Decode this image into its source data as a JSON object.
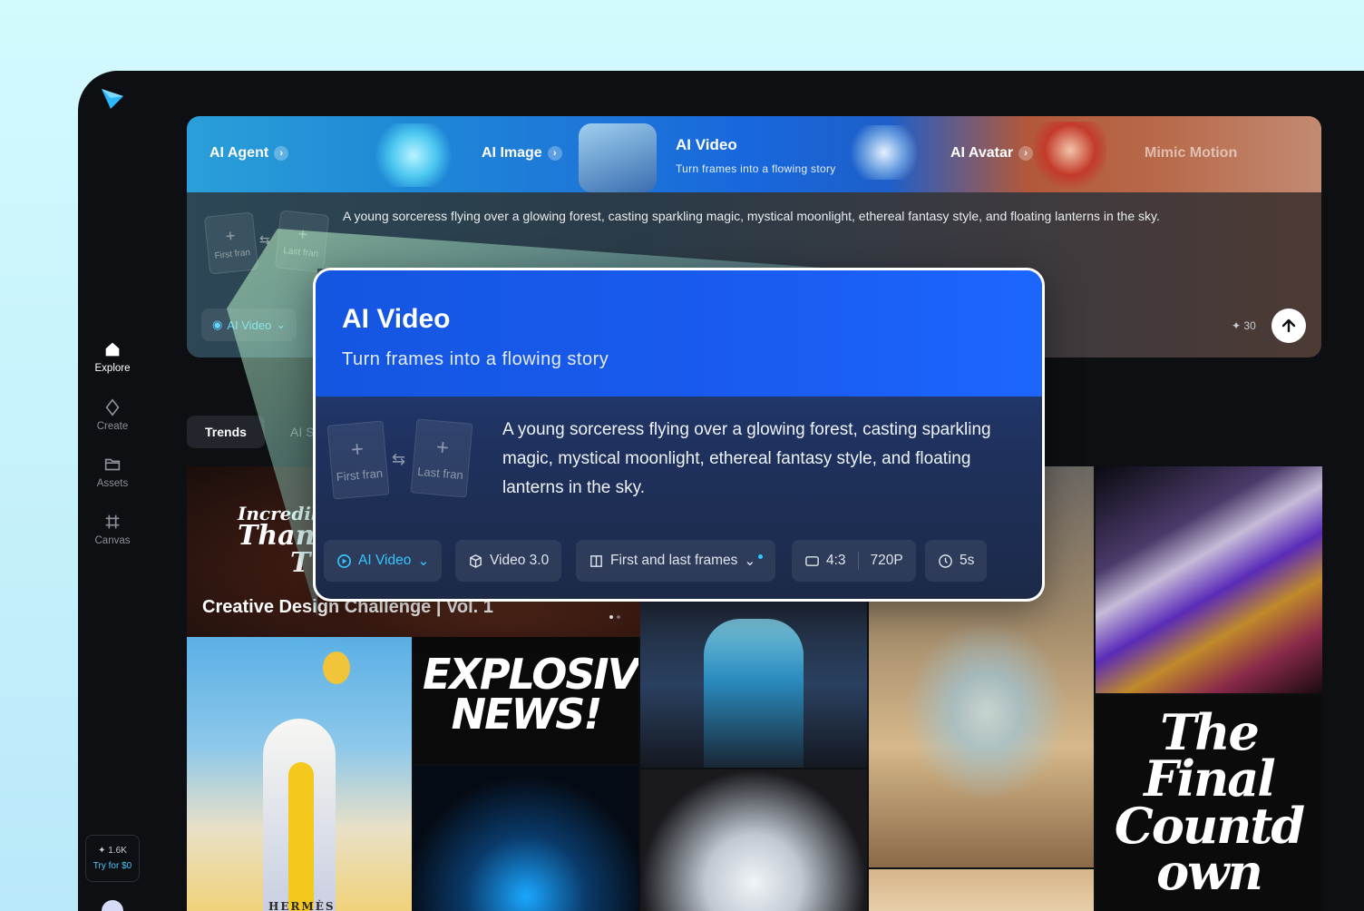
{
  "sidebar": {
    "nav": [
      {
        "label": "Explore",
        "icon": "home-icon",
        "active": true
      },
      {
        "label": "Create",
        "icon": "sparkle-icon",
        "active": false
      },
      {
        "label": "Assets",
        "icon": "folder-icon",
        "active": false
      },
      {
        "label": "Canvas",
        "icon": "canvas-icon",
        "active": false
      }
    ],
    "credits": {
      "count": "1.6K",
      "cta": "Try for $0"
    }
  },
  "banner": {
    "tabs": [
      {
        "label": "AI Agent"
      },
      {
        "label": "AI Image"
      },
      {
        "label": "AI Avatar"
      },
      {
        "label": "Mimic Motion"
      }
    ],
    "active": {
      "title": "AI Video",
      "subtitle": "Turn frames into a flowing story"
    }
  },
  "prompt": {
    "text": "A young sorceress flying over a glowing forest, casting sparkling magic, mystical moonlight, ethereal fantasy style, and floating lanterns in the sky.",
    "first_frame": "First fran",
    "last_frame": "Last fran",
    "mode": "AI Video",
    "cost": "30"
  },
  "tabs": {
    "trends": "Trends",
    "next": "AI S"
  },
  "gallery": {
    "hero_title": "Creative Design Challenge | Vol. 1",
    "hero_script": [
      "Incredible",
      "Thank",
      "T"
    ],
    "explosive": [
      "EXPLOSIVE",
      "NEWS!"
    ],
    "countdown": [
      "The",
      "Final",
      "Countd",
      "own"
    ],
    "hermes": "HERMÈS"
  },
  "popup": {
    "title": "AI Video",
    "subtitle": "Turn frames into a flowing story",
    "text": "A young sorceress flying over a glowing forest, casting sparkling magic, mystical moonlight, ethereal fantasy style, and floating lanterns in the sky.",
    "first_frame": "First fran",
    "last_frame": "Last fran",
    "mode": "AI Video",
    "model": "Video 3.0",
    "frames_mode": "First and last frames",
    "ratio": "4:3",
    "resolution": "720P",
    "duration": "5s"
  },
  "colors": {
    "accent": "#33c6ff",
    "brand_blue": "#1a5bf0"
  }
}
